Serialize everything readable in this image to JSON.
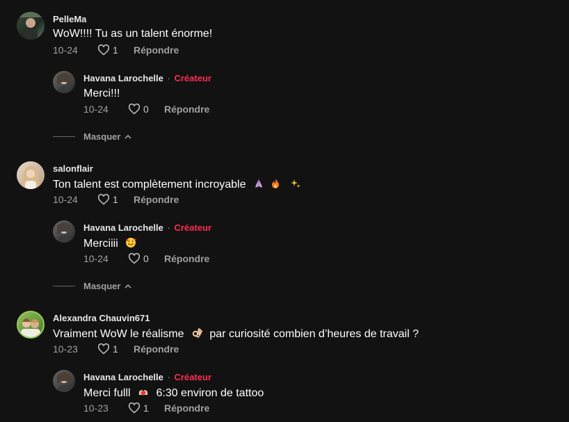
{
  "threads": [
    {
      "author": "PelleMa",
      "text": "WoW!!!! Tu as un talent énorme!",
      "date": "10-24",
      "likes": "1",
      "reply_label": "Répondre",
      "reply": {
        "author": "Havana Larochelle",
        "sep": "·",
        "badge": "Créateur",
        "text": "Merci!!!",
        "date": "10-24",
        "likes": "0",
        "reply_label": "Répondre"
      },
      "hide_label": "Masquer"
    },
    {
      "author": "salonflair",
      "text": "Ton talent est complètement incroyable",
      "emojis": [
        "praying-hands-emoji",
        "fire-emoji",
        "sparkles-emoji"
      ],
      "date": "10-24",
      "likes": "1",
      "reply_label": "Répondre",
      "reply": {
        "author": "Havana Larochelle",
        "sep": "·",
        "badge": "Créateur",
        "text": "Merciiii",
        "emojis": [
          "smiling-face-with-hearts-emoji"
        ],
        "date": "10-24",
        "likes": "0",
        "reply_label": "Répondre"
      },
      "hide_label": "Masquer"
    },
    {
      "author": "Alexandra Chauvin671",
      "text_a": "Vraiment WoW le réalisme",
      "text_b": "par curiosité combien d’heures de travail ?",
      "emojis": [
        "ok-hand-emoji"
      ],
      "date": "10-23",
      "likes": "1",
      "reply_label": "Répondre",
      "reply": {
        "author": "Havana Larochelle",
        "sep": "·",
        "badge": "Créateur",
        "text_a": "Merci fulll",
        "text_b": "6:30 environ de tattoo",
        "emojis": [
          "heart-hands-emoji"
        ],
        "date": "10-23",
        "likes": "1",
        "reply_label": "Répondre"
      }
    }
  ],
  "colors": {
    "background": "#121212",
    "creator_badge": "#fe2c55",
    "meta_text": "#a0a0a0"
  }
}
